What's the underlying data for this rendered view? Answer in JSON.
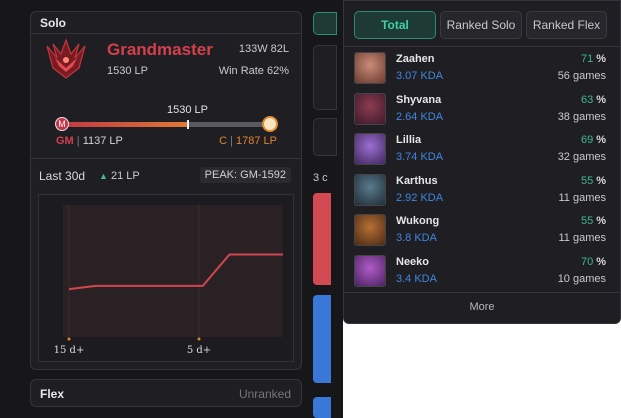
{
  "solo": {
    "title": "Solo",
    "tier": "Grandmaster",
    "record": "133W 82L",
    "lp": "1530 LP",
    "win_rate": "Win Rate 62%",
    "bar": {
      "current_label": "1530 LP",
      "start_badge": "M",
      "left_tier": "GM",
      "left_lp": "1137 LP",
      "right_tier": "C",
      "right_lp": "1787 LP",
      "sep": "|",
      "progress": 0.6
    },
    "last30": "Last 30d",
    "delta": "21 LP",
    "delta_icon": "up-triangle-icon",
    "peak": "PEAK: GM-1592",
    "chart_data": {
      "type": "line",
      "x_labels": [
        "15 d+",
        "5 d+"
      ],
      "series": [
        {
          "values": [
            1509,
            1511,
            1511,
            1511,
            1511,
            1511,
            1530,
            1530,
            1530
          ]
        }
      ]
    }
  },
  "flex": {
    "title": "Flex",
    "status": "Unranked"
  },
  "fragments": {
    "tag_text": "3 c"
  },
  "champions": {
    "tabs": [
      {
        "label": "Total",
        "active": true
      },
      {
        "label": "Ranked Solo",
        "active": false
      },
      {
        "label": "Ranked Flex",
        "active": false
      }
    ],
    "list": [
      {
        "name": "Zaahen",
        "kda": "3.07 KDA",
        "wr": "71",
        "pct": "%",
        "games": "56 games",
        "icon": "zaahen-avatar"
      },
      {
        "name": "Shyvana",
        "kda": "2.64 KDA",
        "wr": "63",
        "pct": "%",
        "games": "38 games",
        "icon": "shyvana-avatar"
      },
      {
        "name": "Lillia",
        "kda": "3.74 KDA",
        "wr": "69",
        "pct": "%",
        "games": "32 games",
        "icon": "lillia-avatar"
      },
      {
        "name": "Karthus",
        "kda": "2.92 KDA",
        "wr": "55",
        "pct": "%",
        "games": "11 games",
        "icon": "karthus-avatar"
      },
      {
        "name": "Wukong",
        "kda": "3.8 KDA",
        "wr": "55",
        "pct": "%",
        "games": "11 games",
        "icon": "wukong-avatar"
      },
      {
        "name": "Neeko",
        "kda": "3.4 KDA",
        "wr": "70",
        "pct": "%",
        "games": "10 games",
        "icon": "neeko-avatar"
      }
    ],
    "more_label": "More"
  },
  "colors": {
    "accent_teal": "#3cd0a8",
    "grandmaster_red": "#d3404c",
    "challenger_orange": "#e0822f",
    "kda_blue": "#3f86e0",
    "winrate_green": "#3fb98a"
  }
}
